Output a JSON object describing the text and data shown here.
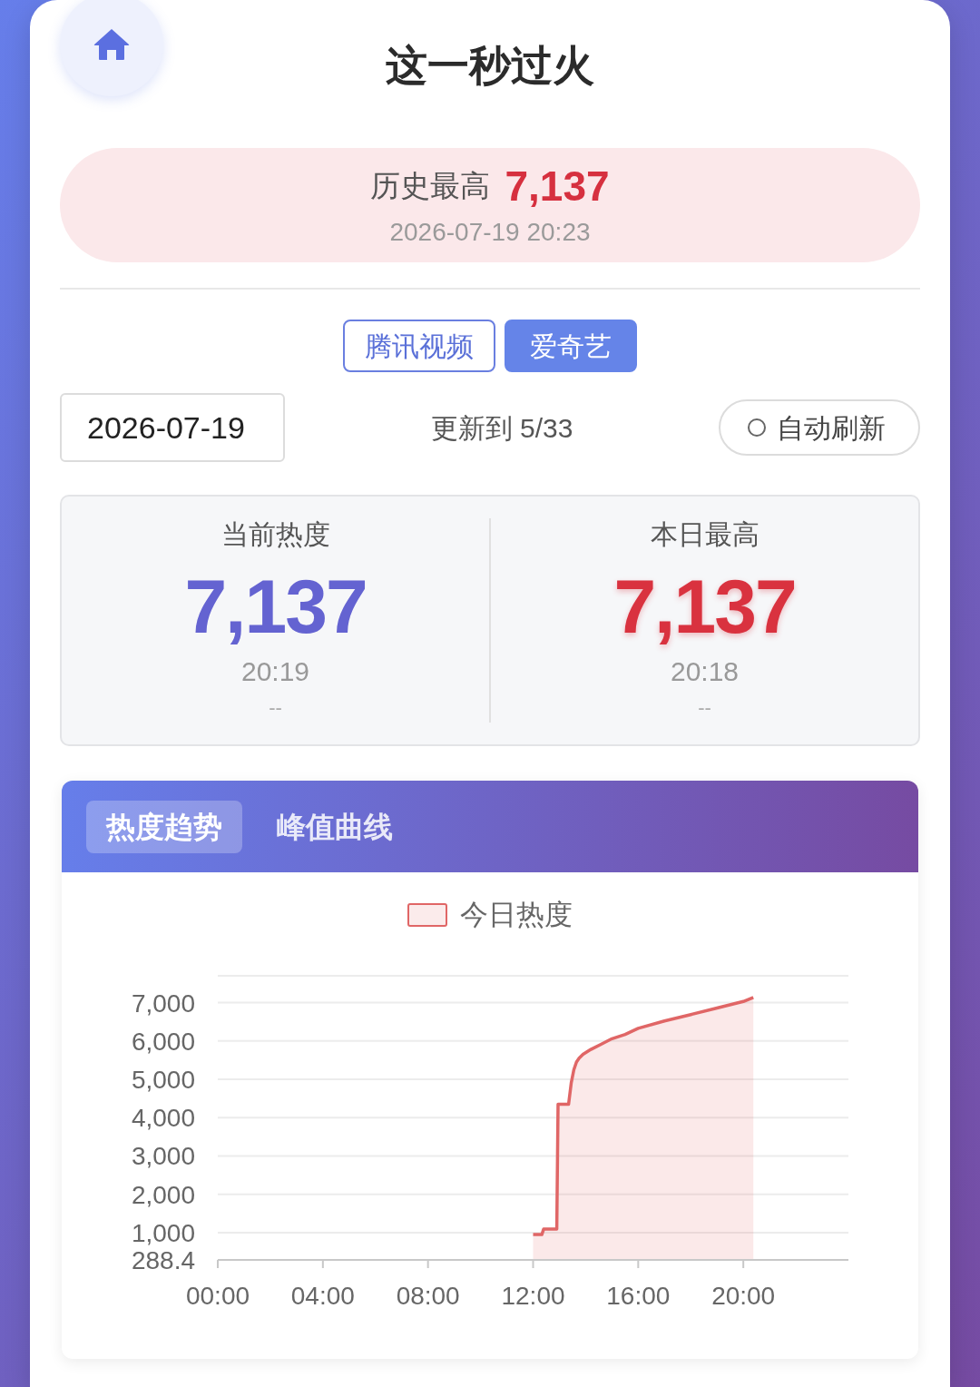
{
  "header": {
    "title": "这一秒过火"
  },
  "record": {
    "label": "历史最高",
    "value": "7,137",
    "time": "2026-07-19 20:23"
  },
  "platforms": [
    {
      "label": "腾讯视频",
      "selected": false
    },
    {
      "label": "爱奇艺",
      "selected": true
    }
  ],
  "controls": {
    "date_field": {
      "value": "2026-07-19"
    },
    "episode_status": "更新到 5/33",
    "auto_refresh": {
      "label": "自动刷新",
      "on": false
    }
  },
  "stats": [
    {
      "kind": "current",
      "label": "当前热度",
      "value": "7,137",
      "time": "20:19",
      "note": "--"
    },
    {
      "kind": "peak",
      "label": "本日最高",
      "value": "7,137",
      "time": "20:18",
      "note": "--"
    }
  ],
  "chart_tabs": [
    {
      "label": "热度趋势",
      "selected": true
    },
    {
      "label": "峰值曲线",
      "selected": false
    }
  ],
  "chart": {
    "chart_data": {
      "type": "area",
      "grid": true,
      "x": [
        12.0,
        12.33,
        12.4,
        12.9,
        12.95,
        13.35,
        13.45,
        13.55,
        13.65,
        13.75,
        13.9,
        14.2,
        14.6,
        15.0,
        15.5,
        16.0,
        17.0,
        18.0,
        19.0,
        20.0,
        20.38
      ],
      "series": [
        {
          "name": "今日热度",
          "color": "#e06666",
          "values": [
            950,
            950,
            1090,
            1090,
            4350,
            4350,
            4900,
            5250,
            5450,
            5550,
            5650,
            5780,
            5920,
            6060,
            6170,
            6330,
            6520,
            6690,
            6860,
            7030,
            7137
          ]
        }
      ],
      "xlim": [
        0,
        24
      ],
      "ylim": [
        288.4,
        7700
      ],
      "xticks": [
        {
          "value": 0,
          "label": "00:00"
        },
        {
          "value": 4,
          "label": "04:00"
        },
        {
          "value": 8,
          "label": "08:00"
        },
        {
          "value": 12,
          "label": "12:00"
        },
        {
          "value": 16,
          "label": "16:00"
        },
        {
          "value": 20,
          "label": "20:00"
        }
      ],
      "yticks": [
        {
          "value": 288.4,
          "label": "288.4"
        },
        {
          "value": 1000,
          "label": "1,000"
        },
        {
          "value": 2000,
          "label": "2,000"
        },
        {
          "value": 3000,
          "label": "3,000"
        },
        {
          "value": 4000,
          "label": "4,000"
        },
        {
          "value": 5000,
          "label": "5,000"
        },
        {
          "value": 6000,
          "label": "6,000"
        },
        {
          "value": 7000,
          "label": "7,000"
        }
      ]
    }
  }
}
